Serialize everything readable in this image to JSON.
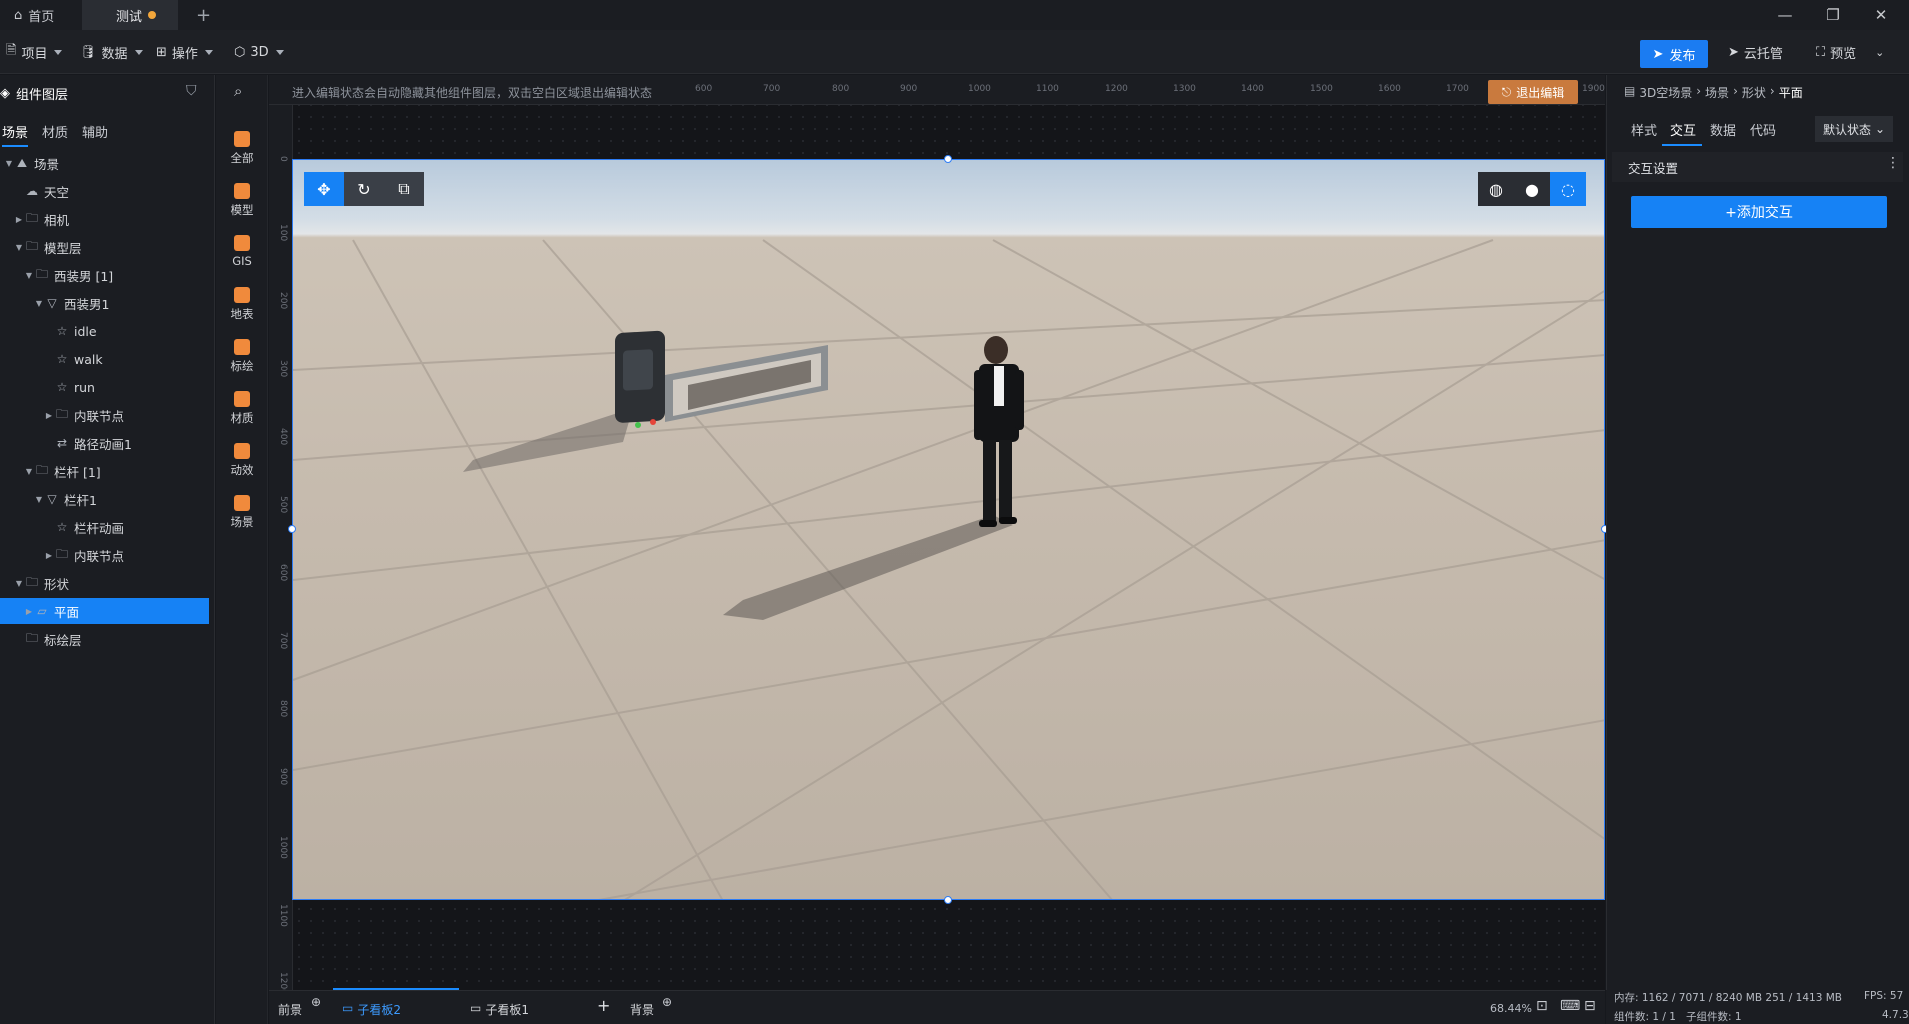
{
  "titlebar": {
    "tabs": [
      {
        "label": "首页",
        "icon": "home-icon"
      },
      {
        "label": "测试",
        "unsaved": true
      }
    ],
    "new_tab": "+",
    "window": {
      "minimize": "—",
      "restore": "❐",
      "close": "✕"
    }
  },
  "menubar": {
    "items": [
      "项目",
      "数据",
      "操作",
      "3D"
    ],
    "publish": "发布",
    "cloud": "云托管",
    "preview": "预览"
  },
  "left_panel": {
    "title": "组件图层",
    "tabs": [
      "场景",
      "材质",
      "辅助"
    ],
    "tree": [
      {
        "label": "场景",
        "level": 0,
        "arrow": "down",
        "icon": "mountain-icon"
      },
      {
        "label": "天空",
        "level": 1,
        "arrow": "",
        "icon": "cloud-icon"
      },
      {
        "label": "相机",
        "level": 1,
        "arrow": "right",
        "icon": "folder-icon"
      },
      {
        "label": "模型层",
        "level": 1,
        "arrow": "down",
        "icon": "folder-icon"
      },
      {
        "label": "西装男 [1]",
        "level": 2,
        "arrow": "down",
        "icon": "folder-icon"
      },
      {
        "label": "西装男1",
        "level": 3,
        "arrow": "down",
        "icon": "model-icon"
      },
      {
        "label": "idle",
        "level": 4,
        "arrow": "",
        "icon": "star-icon"
      },
      {
        "label": "walk",
        "level": 4,
        "arrow": "",
        "icon": "star-icon"
      },
      {
        "label": "run",
        "level": 4,
        "arrow": "",
        "icon": "star-icon"
      },
      {
        "label": "内联节点",
        "level": 4,
        "arrow": "right",
        "icon": "folder-icon"
      },
      {
        "label": "路径动画1",
        "level": 4,
        "arrow": "",
        "icon": "path-icon"
      },
      {
        "label": "栏杆 [1]",
        "level": 2,
        "arrow": "down",
        "icon": "folder-icon"
      },
      {
        "label": "栏杆1",
        "level": 3,
        "arrow": "down",
        "icon": "model-icon"
      },
      {
        "label": "栏杆动画",
        "level": 4,
        "arrow": "",
        "icon": "star-icon"
      },
      {
        "label": "内联节点",
        "level": 4,
        "arrow": "right",
        "icon": "folder-icon"
      },
      {
        "label": "形状",
        "level": 1,
        "arrow": "down",
        "icon": "folder-icon"
      },
      {
        "label": "平面",
        "level": 2,
        "arrow": "right",
        "icon": "plane-icon",
        "selected": true
      },
      {
        "label": "标绘层",
        "level": 1,
        "arrow": "",
        "icon": "folder-icon"
      }
    ]
  },
  "tools": [
    {
      "label": "全部",
      "color": "#f08a3c"
    },
    {
      "label": "模型",
      "color": "#f08a3c"
    },
    {
      "label": "GIS",
      "color": "#f08a3c"
    },
    {
      "label": "地表",
      "color": "#f08a3c"
    },
    {
      "label": "标绘",
      "color": "#f08a3c"
    },
    {
      "label": "材质",
      "color": "#f08a3c"
    },
    {
      "label": "动效",
      "color": "#f08a3c"
    },
    {
      "label": "场景",
      "color": "#f08a3c"
    }
  ],
  "canvas": {
    "hint": "进入编辑状态会自动隐藏其他组件图层，双击空白区域退出编辑状态",
    "exit_edit": "退出编辑",
    "ruler_top": [
      "600",
      "700",
      "800",
      "900",
      "1000",
      "1100",
      "1200",
      "1300",
      "1400",
      "1500",
      "1600",
      "1700",
      "1900"
    ],
    "ruler_left": [
      "0",
      "100",
      "200",
      "300",
      "400",
      "500",
      "600",
      "700",
      "800",
      "900",
      "1000",
      "1100",
      "1200"
    ],
    "scene_tools_left": [
      "move-icon",
      "rotate-icon",
      "scale-icon"
    ],
    "scene_tools_right": [
      "globe-icon",
      "sphere-icon",
      "orbit-icon"
    ]
  },
  "right_panel": {
    "breadcrumb": [
      "3D空场景",
      "场景",
      "形状",
      "平面"
    ],
    "tabs": [
      "样式",
      "交互",
      "数据",
      "代码"
    ],
    "active_tab": "交互",
    "state_select": "默认状态",
    "section": "交互设置",
    "add_button": "+添加交互"
  },
  "bottom": {
    "tabs": [
      "前景",
      "子看板2",
      "子看板1",
      "背景"
    ],
    "zoom": "68.44%"
  },
  "status": {
    "memory": "内存: 1162 / 7071 / 8240 MB  251 / 1413 MB",
    "fps": "FPS: 57",
    "components": "组件数: 1 / 1",
    "subcomponents": "子组件数: 1",
    "version": "4.7.3"
  },
  "colors": {
    "accent": "#1682f5",
    "exit": "#c97a3e",
    "unsaved_dot": "#f2a63b"
  }
}
